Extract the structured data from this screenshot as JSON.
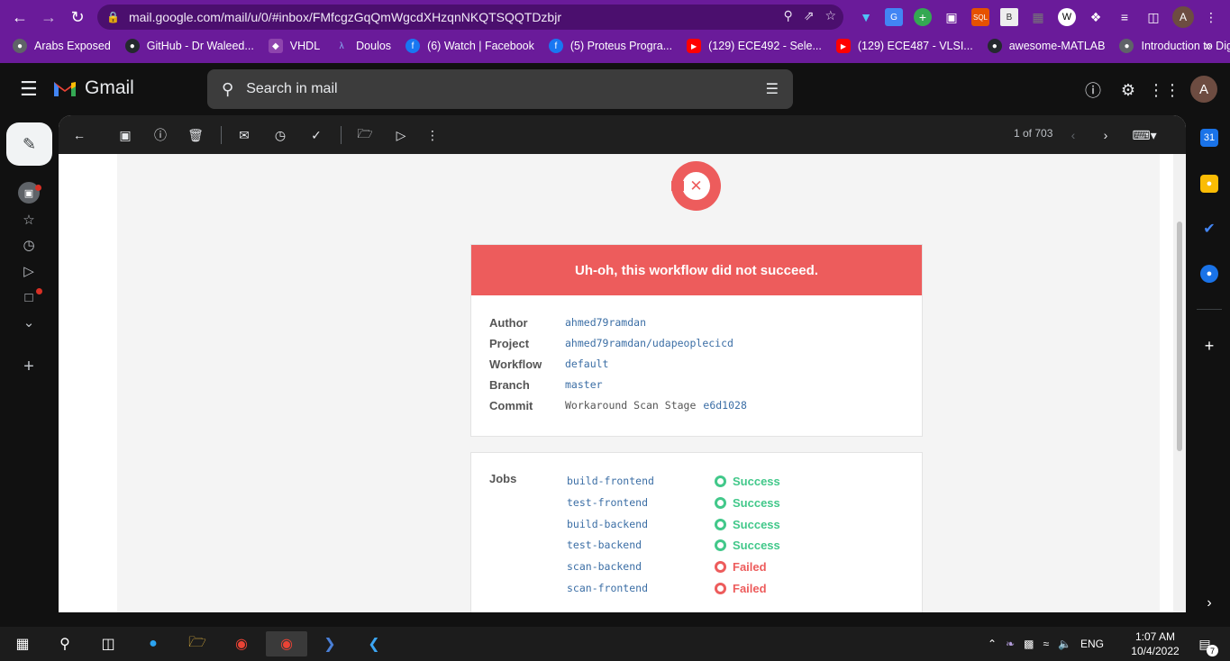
{
  "browser": {
    "url": "mail.google.com/mail/u/0/#inbox/FMfcgzGqQmWgcdXHzqnNKQTSQQTDzbjr",
    "profile_initial": "A"
  },
  "bookmarks": [
    {
      "label": "Arabs Exposed",
      "icon": "globe-icon",
      "color": "#5f6368"
    },
    {
      "label": "GitHub - Dr Waleed...",
      "icon": "github-icon",
      "color": "#24292e"
    },
    {
      "label": "VHDL",
      "icon": "shield-icon",
      "color": "#8e44ad"
    },
    {
      "label": "Doulos",
      "icon": "runner-icon",
      "color": "#1a73e8"
    },
    {
      "label": "(6) Watch | Facebook",
      "icon": "facebook-icon",
      "color": "#1877f2"
    },
    {
      "label": "(5) Proteus Progra...",
      "icon": "facebook-icon",
      "color": "#1877f2"
    },
    {
      "label": "(129) ECE492 - Sele...",
      "icon": "youtube-icon",
      "color": "#ff0000"
    },
    {
      "label": "(129) ECE487 - VLSI...",
      "icon": "youtube-icon",
      "color": "#ff0000"
    },
    {
      "label": "awesome-MATLAB",
      "icon": "github-icon",
      "color": "#24292e"
    },
    {
      "label": "Introduction to Digi...",
      "icon": "globe-icon",
      "color": "#5f6368"
    }
  ],
  "gmail": {
    "brand": "Gmail",
    "search_placeholder": "Search in mail",
    "avatar_initial": "A",
    "pager": "1 of 703"
  },
  "email": {
    "banner": "Uh-oh, this workflow did not succeed.",
    "meta": [
      {
        "label": "Author",
        "value": "ahmed79ramdan"
      },
      {
        "label": "Project",
        "value": "ahmed79ramdan/udapeoplecicd"
      },
      {
        "label": "Workflow",
        "value": "default"
      },
      {
        "label": "Branch",
        "value": "master"
      },
      {
        "label": "Commit",
        "value": "Workaround Scan Stage",
        "hash": "e6d1028"
      }
    ],
    "jobs_label": "Jobs",
    "jobs": [
      {
        "name": "build-frontend",
        "status": "Success"
      },
      {
        "name": "test-frontend",
        "status": "Success"
      },
      {
        "name": "build-backend",
        "status": "Success"
      },
      {
        "name": "test-backend",
        "status": "Success"
      },
      {
        "name": "scan-backend",
        "status": "Failed"
      },
      {
        "name": "scan-frontend",
        "status": "Failed"
      }
    ],
    "colors": {
      "fail": "#ed5c5c",
      "success": "#42c88a",
      "link": "#3b6ea5"
    }
  },
  "taskbar": {
    "language": "ENG",
    "time": "1:07 AM",
    "date": "10/4/2022",
    "notification_count": "7"
  }
}
